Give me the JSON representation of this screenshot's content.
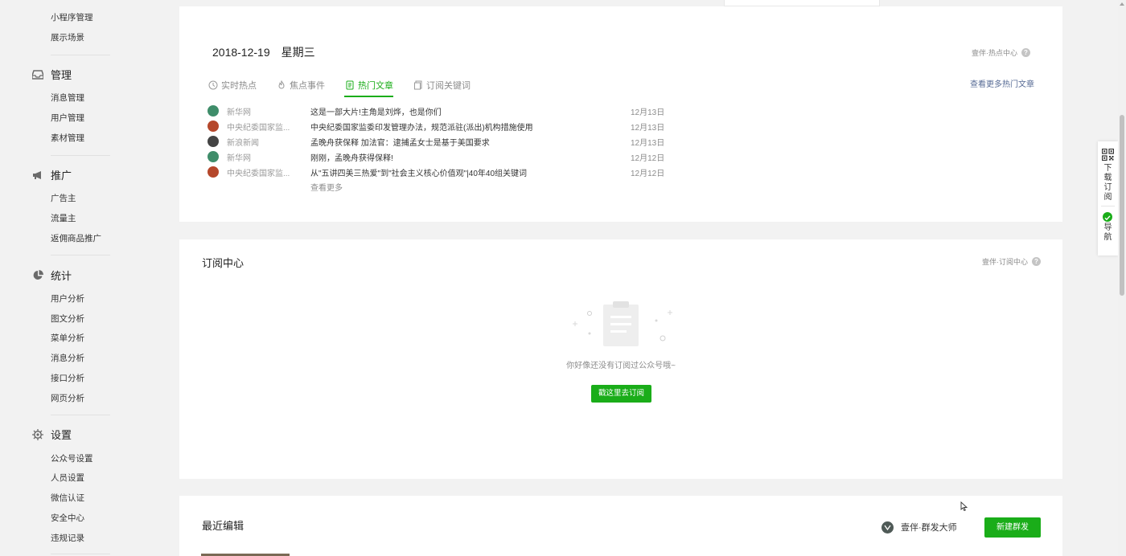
{
  "sidebar": {
    "top_items": [
      "小程序管理",
      "展示场景"
    ],
    "groups": [
      {
        "title": "管理",
        "icon": "inbox-icon",
        "items": [
          "消息管理",
          "用户管理",
          "素材管理"
        ]
      },
      {
        "title": "推广",
        "icon": "megaphone-icon",
        "items": [
          "广告主",
          "流量主",
          "返佣商品推广"
        ]
      },
      {
        "title": "统计",
        "icon": "pie-chart-icon",
        "items": [
          "用户分析",
          "图文分析",
          "菜单分析",
          "消息分析",
          "接口分析",
          "网页分析"
        ]
      },
      {
        "title": "设置",
        "icon": "gear-icon",
        "items": [
          "公众号设置",
          "人员设置",
          "微信认证",
          "安全中心",
          "违规记录"
        ]
      }
    ]
  },
  "hot": {
    "date": "2018-12-19",
    "weekday": "星期三",
    "center_label": "壹伴·热点中心",
    "tabs": [
      "实时热点",
      "焦点事件",
      "热门文章",
      "订阅关键词"
    ],
    "active_tab": "热门文章",
    "more_link": "查看更多热门文章",
    "articles": [
      {
        "source": "新华网",
        "title": "这是一部大片!主角是刘烨，也是你们",
        "date": "12月13日",
        "logo_color": "#3f8d6a"
      },
      {
        "source": "中央纪委国家监...",
        "title": "中央纪委国家监委印发管理办法，规范派驻(派出)机构措施使用",
        "date": "12月13日",
        "logo_color": "#b5472b"
      },
      {
        "source": "新浪新闻",
        "title": "孟晚舟获保释 加法官：逮捕孟女士是基于美国要求",
        "date": "12月13日",
        "logo_color": "#444444"
      },
      {
        "source": "新华网",
        "title": "刚刚，孟晚舟获得保释!",
        "date": "12月12日",
        "logo_color": "#3f8d6a"
      },
      {
        "source": "中央纪委国家监...",
        "title": "从\"五讲四美三热爱\"到\"社会主义核心价值观\"|40年40组关键词",
        "date": "12月12日",
        "logo_color": "#b5472b"
      }
    ],
    "see_more": "查看更多"
  },
  "subscription": {
    "title": "订阅中心",
    "center_label": "壹伴·订阅中心",
    "empty_text": "你好像还没有订阅过公众号哦~",
    "button": "戳这里去订阅"
  },
  "recent": {
    "title": "最近编辑",
    "group_master": "壹伴·群发大师",
    "new_button": "新建群发"
  },
  "floater": {
    "download": "下载订阅",
    "nav": "导航"
  },
  "colors": {
    "accent": "#1aad19",
    "link": "#576b95"
  }
}
